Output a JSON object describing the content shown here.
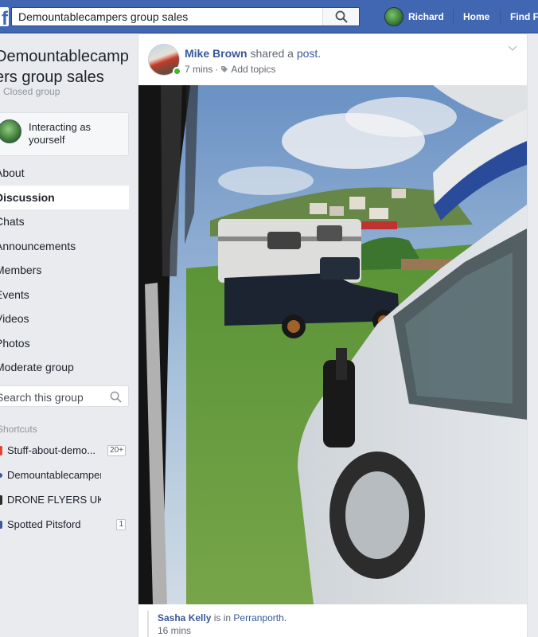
{
  "topbar": {
    "logo": "f",
    "search_value": "Demountablecampers group sales",
    "user_name": "Richard",
    "nav": [
      "Home",
      "Find F"
    ]
  },
  "sidebar": {
    "group_title": "Demountablecamp ers group sales",
    "privacy": "Closed group",
    "interacting": "Interacting as yourself",
    "menu": [
      {
        "label": "About",
        "active": false
      },
      {
        "label": "Discussion",
        "active": true
      },
      {
        "label": "Chats",
        "active": false
      },
      {
        "label": "Announcements",
        "active": false
      },
      {
        "label": "Members",
        "active": false
      },
      {
        "label": "Events",
        "active": false
      },
      {
        "label": "Videos",
        "active": false
      },
      {
        "label": "Photos",
        "active": false
      },
      {
        "label": "Moderate group",
        "active": false
      }
    ],
    "search_placeholder": "Search this group",
    "shortcuts_heading": "Shortcuts",
    "shortcuts": [
      {
        "label": "Stuff-about-demo...",
        "badge": "20+",
        "color": "#e0452d"
      },
      {
        "label": "Demountablecampers ...",
        "badge": "",
        "color": "#3b5998"
      },
      {
        "label": "DRONE FLYERS UK & Ir...",
        "badge": "",
        "color": "#2b2b2b"
      },
      {
        "label": "Spotted Pitsford",
        "badge": "1",
        "color": "#3b5998"
      }
    ]
  },
  "post": {
    "author": "Mike Brown",
    "action": "shared a",
    "object": "post.",
    "time": "7 mins",
    "topics": "Add topics",
    "shared_author": "Sasha Kelly",
    "shared_is_in": "is in",
    "shared_place": "Perranporth.",
    "shared_time": "16 mins"
  },
  "colors": {
    "brand": "#4267b2",
    "link": "#385898",
    "online": "#42b72a"
  }
}
